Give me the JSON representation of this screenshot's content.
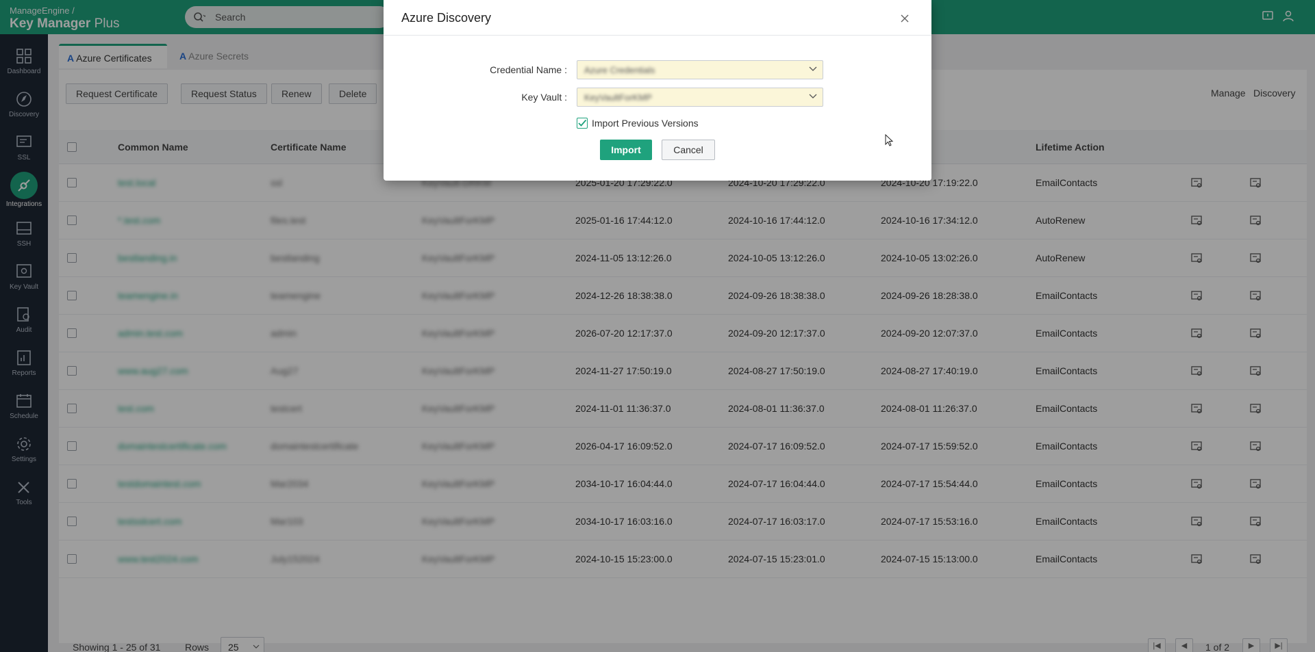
{
  "brand": {
    "vendor": "ManageEngine /",
    "product": "Key Manager",
    "product_suffix": "Plus"
  },
  "search": {
    "placeholder": "Search"
  },
  "sidebar": {
    "items": [
      {
        "label": "Dashboard",
        "icon": "dashboard-icon"
      },
      {
        "label": "Discovery",
        "icon": "compass-icon"
      },
      {
        "label": "SSL",
        "icon": "ssl-certificate-icon"
      },
      {
        "label": "Integrations",
        "icon": "integrations-icon",
        "active": true
      },
      {
        "label": "SSH",
        "icon": "terminal-icon"
      },
      {
        "label": "Key Vault",
        "icon": "key-vault-icon"
      },
      {
        "label": "Audit",
        "icon": "audit-icon"
      },
      {
        "label": "Reports",
        "icon": "reports-icon"
      },
      {
        "label": "Schedule",
        "icon": "calendar-icon"
      },
      {
        "label": "Settings",
        "icon": "gear-icon"
      },
      {
        "label": "Tools",
        "icon": "tools-icon"
      }
    ]
  },
  "tabs": {
    "certificates": "Azure Certificates",
    "secrets": "Azure Secrets"
  },
  "toolbar": {
    "request_certificate": "Request Certificate",
    "request_status": "Request Status",
    "renew": "Renew",
    "delete": "Delete",
    "manage": "Manage",
    "discovery": "Discovery"
  },
  "table": {
    "columns": {
      "common_name": "Common Name",
      "certificate_name": "Certificate Name",
      "lifetime_action": "Lifetime Action"
    },
    "rows": [
      {
        "cn": "test.local",
        "cert": "ssl",
        "vault": "KeyVault-DRKM",
        "expiry": "2025-01-20 17:29:22.0",
        "created": "2024-10-20 17:29:22.0",
        "updated": "2024-10-20 17:19:22.0",
        "action": "EmailContacts"
      },
      {
        "cn": "*.test.com",
        "cert": "files.test",
        "vault": "KeyVaultForKMP",
        "expiry": "2025-01-16 17:44:12.0",
        "created": "2024-10-16 17:44:12.0",
        "updated": "2024-10-16 17:34:12.0",
        "action": "AutoRenew"
      },
      {
        "cn": "bestlanding.in",
        "cert": "bestlanding",
        "vault": "KeyVaultForKMP",
        "expiry": "2024-11-05 13:12:26.0",
        "created": "2024-10-05 13:12:26.0",
        "updated": "2024-10-05 13:02:26.0",
        "action": "AutoRenew"
      },
      {
        "cn": "teamengine.in",
        "cert": "teamengine",
        "vault": "KeyVaultForKMP",
        "expiry": "2024-12-26 18:38:38.0",
        "created": "2024-09-26 18:38:38.0",
        "updated": "2024-09-26 18:28:38.0",
        "action": "EmailContacts"
      },
      {
        "cn": "admin.test.com",
        "cert": "admin",
        "vault": "KeyVaultForKMP",
        "expiry": "2026-07-20 12:17:37.0",
        "created": "2024-09-20 12:17:37.0",
        "updated": "2024-09-20 12:07:37.0",
        "action": "EmailContacts"
      },
      {
        "cn": "www.aug27.com",
        "cert": "Aug27",
        "vault": "KeyVaultForKMP",
        "expiry": "2024-11-27 17:50:19.0",
        "created": "2024-08-27 17:50:19.0",
        "updated": "2024-08-27 17:40:19.0",
        "action": "EmailContacts"
      },
      {
        "cn": "test.com",
        "cert": "testcert",
        "vault": "KeyVaultForKMP",
        "expiry": "2024-11-01 11:36:37.0",
        "created": "2024-08-01 11:36:37.0",
        "updated": "2024-08-01 11:26:37.0",
        "action": "EmailContacts"
      },
      {
        "cn": "domaintestcertificate.com",
        "cert": "domaintestcertificate",
        "vault": "KeyVaultForKMP",
        "expiry": "2026-04-17 16:09:52.0",
        "created": "2024-07-17 16:09:52.0",
        "updated": "2024-07-17 15:59:52.0",
        "action": "EmailContacts"
      },
      {
        "cn": "testdomaintest.com",
        "cert": "Mar2034",
        "vault": "KeyVaultForKMP",
        "expiry": "2034-10-17 16:04:44.0",
        "created": "2024-07-17 16:04:44.0",
        "updated": "2024-07-17 15:54:44.0",
        "action": "EmailContacts"
      },
      {
        "cn": "testsslcert.com",
        "cert": "Mar103",
        "vault": "KeyVaultForKMP",
        "expiry": "2034-10-17 16:03:16.0",
        "created": "2024-07-17 16:03:17.0",
        "updated": "2024-07-17 15:53:16.0",
        "action": "EmailContacts"
      },
      {
        "cn": "www.test2024.com",
        "cert": "July152024",
        "vault": "KeyVaultForKMP",
        "expiry": "2024-10-15 15:23:00.0",
        "created": "2024-07-15 15:23:01.0",
        "updated": "2024-07-15 15:13:00.0",
        "action": "EmailContacts"
      }
    ]
  },
  "footer": {
    "showing": "Showing 1 - 25 of 31",
    "rows_label": "Rows",
    "rows_value": "25",
    "page": "1 of 2"
  },
  "modal": {
    "title": "Azure Discovery",
    "credential_label": "Credential Name :",
    "credential_value": "Azure Credentials",
    "keyvault_label": "Key Vault :",
    "keyvault_value": "KeyVaultForKMP",
    "import_prev_label": "Import Previous Versions",
    "import_prev_checked": true,
    "import_button": "Import",
    "cancel_button": "Cancel"
  },
  "colors": {
    "accent": "#1fa27d",
    "sidebar": "#1e2734",
    "field_bg": "#fbf6d9"
  }
}
